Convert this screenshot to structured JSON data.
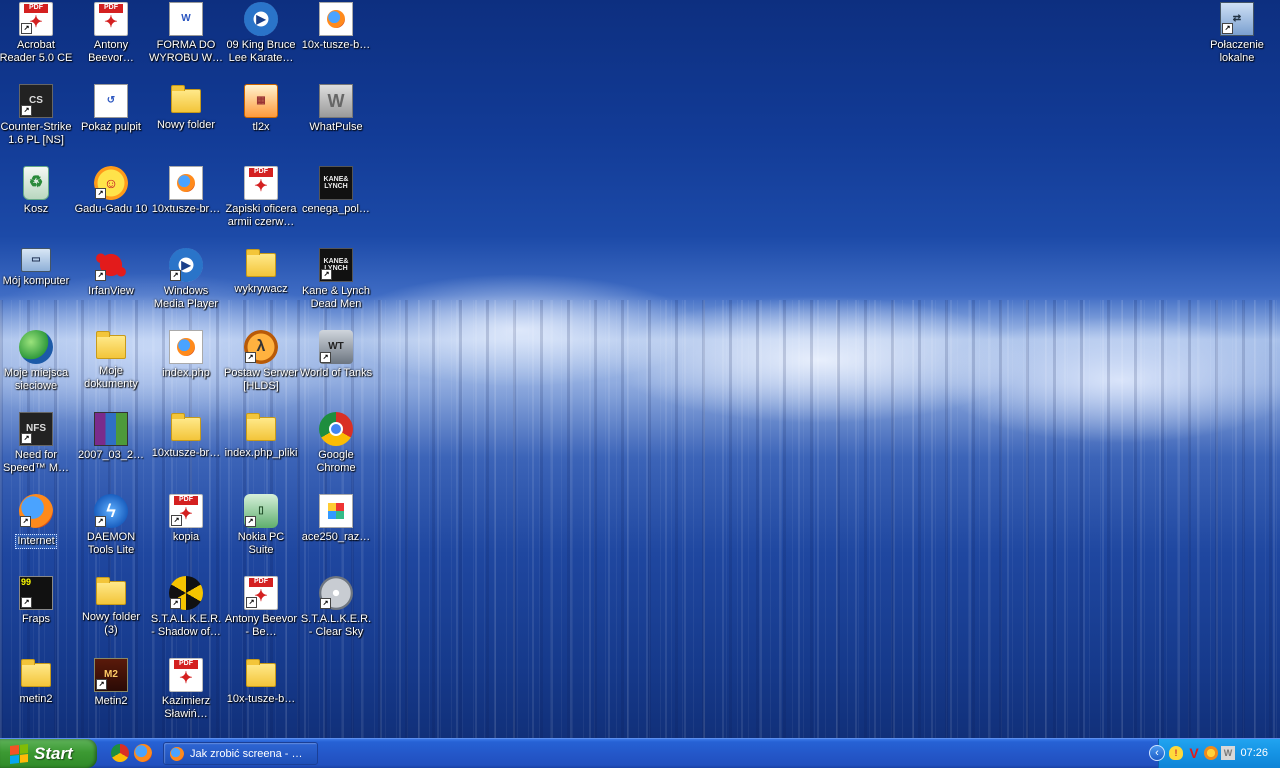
{
  "desktop": {
    "icons": [
      {
        "label": "Acrobat Reader 5.0 CE"
      },
      {
        "label": "Antony Beevor…"
      },
      {
        "label": "FORMA DO WYROBU W…"
      },
      {
        "label": "09 King Bruce Lee Karate…"
      },
      {
        "label": "10x-tusze-b…"
      },
      {
        "label": "Counter-Strike 1.6 PL [NS]"
      },
      {
        "label": "Pokaż pulpit"
      },
      {
        "label": "Nowy folder"
      },
      {
        "label": "tl2x"
      },
      {
        "label": "WhatPulse"
      },
      {
        "label": "Kosz"
      },
      {
        "label": "Gadu-Gadu 10"
      },
      {
        "label": "10xtusze-br…"
      },
      {
        "label": "Zapiski oficera armii czerw…"
      },
      {
        "label": "cenega_pol…"
      },
      {
        "label": "Mój komputer"
      },
      {
        "label": "IrfanView"
      },
      {
        "label": "Windows Media Player"
      },
      {
        "label": "wykrywacz"
      },
      {
        "label": "Kane & Lynch Dead Men"
      },
      {
        "label": "Moje miejsca sieciowe"
      },
      {
        "label": "Moje dokumenty"
      },
      {
        "label": "index.php"
      },
      {
        "label": "Postaw Serwer [HLDS]"
      },
      {
        "label": "World of Tanks"
      },
      {
        "label": "Need for Speed™ M…"
      },
      {
        "label": "2007_03_2…"
      },
      {
        "label": "10xtusze-br…"
      },
      {
        "label": "index.php_pliki"
      },
      {
        "label": "Google Chrome"
      },
      {
        "label": "Internet"
      },
      {
        "label": "DAEMON Tools Lite"
      },
      {
        "label": "kopia"
      },
      {
        "label": "Nokia PC Suite"
      },
      {
        "label": "ace250_raz…"
      },
      {
        "label": "Fraps"
      },
      {
        "label": "Nowy folder (3)"
      },
      {
        "label": "S.T.A.L.K.E.R. - Shadow of…"
      },
      {
        "label": "Antony Beevor - Be…"
      },
      {
        "label": "S.T.A.L.K.E.R. - Clear Sky"
      },
      {
        "label": "metin2"
      },
      {
        "label": "Metin2"
      },
      {
        "label": "Kazimierz Sławiń…"
      },
      {
        "label": "10x-tusze-b…"
      },
      {
        "label": "Połaczenie lokalne"
      }
    ]
  },
  "taskbar": {
    "start_label": "Start",
    "task_title": "Jak zrobić screena - …",
    "clock": "07:26"
  },
  "colors": {
    "taskbar": "#2457c9",
    "start_button": "#3c9a33",
    "tray": "#1593e4"
  }
}
